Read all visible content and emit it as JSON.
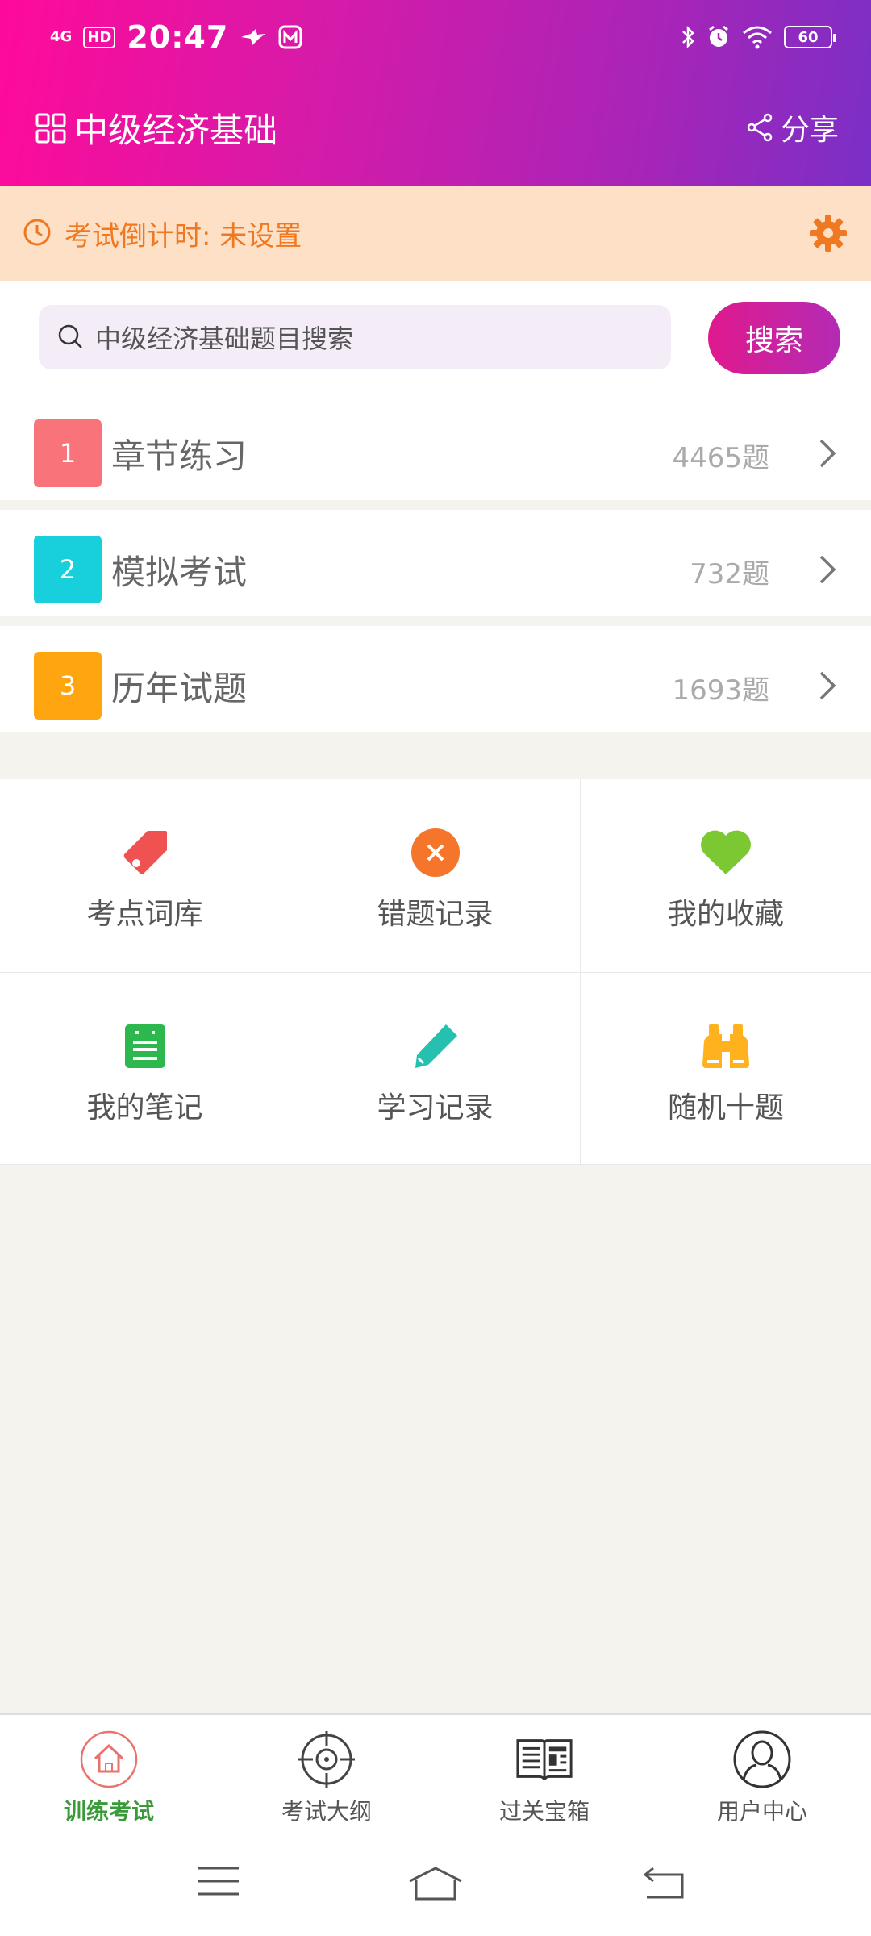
{
  "status_bar": {
    "network": "4G",
    "hd": "HD",
    "time": "20:47",
    "battery": "60"
  },
  "header": {
    "title": "中级经济基础",
    "share_label": "分享"
  },
  "countdown": {
    "text": "考试倒计时: 未设置"
  },
  "search": {
    "placeholder": "中级经济基础题目搜索",
    "button_label": "搜索"
  },
  "list": [
    {
      "index": "1",
      "label": "章节练习",
      "count": "4465题",
      "color": "#f8737a"
    },
    {
      "index": "2",
      "label": "模拟考试",
      "count": "732题",
      "color": "#18cfdc"
    },
    {
      "index": "3",
      "label": "历年试题",
      "count": "1693题",
      "color": "#ffa510"
    }
  ],
  "grid": [
    {
      "label": "考点词库",
      "icon": "tag-icon",
      "color": "#f05252"
    },
    {
      "label": "错题记录",
      "icon": "close-circle-icon",
      "color": "#f5752a"
    },
    {
      "label": "我的收藏",
      "icon": "heart-icon",
      "color": "#7bc832"
    },
    {
      "label": "我的笔记",
      "icon": "notebook-icon",
      "color": "#2cb84c"
    },
    {
      "label": "学习记录",
      "icon": "pencil-icon",
      "color": "#26c0b0"
    },
    {
      "label": "随机十题",
      "icon": "binoculars-icon",
      "color": "#ffb21e"
    }
  ],
  "tabs": [
    {
      "label": "训练考试",
      "icon": "home-icon",
      "active": true
    },
    {
      "label": "考试大纲",
      "icon": "target-icon",
      "active": false
    },
    {
      "label": "过关宝箱",
      "icon": "newspaper-icon",
      "active": false
    },
    {
      "label": "用户中心",
      "icon": "user-icon",
      "active": false
    }
  ],
  "colors": {
    "accent_pink": "#e0198e",
    "accent_purple": "#7a2fc6",
    "countdown_orange": "#f07820",
    "active_tab_green": "#3a9a3a"
  }
}
